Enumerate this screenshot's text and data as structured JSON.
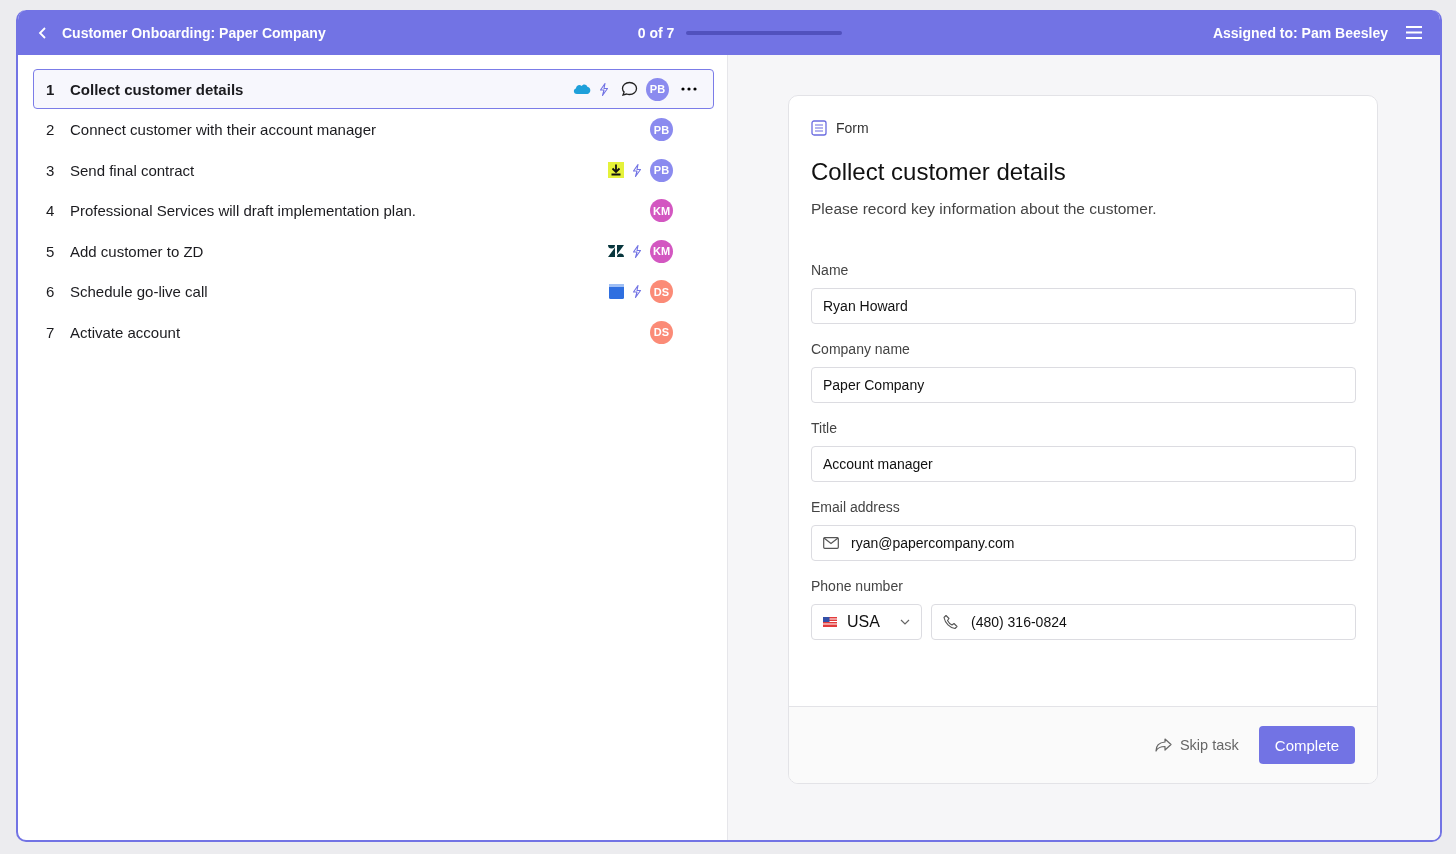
{
  "header": {
    "title": "Customer Onboarding: Paper Company",
    "progress": {
      "text": "0 of 7",
      "level": 0
    },
    "assignee": "Assigned to: Pam Beesley"
  },
  "tasks": [
    {
      "number": "1",
      "title": "Collect customer details",
      "selected": true,
      "kind": "salesforce",
      "automated": true,
      "avatar": {
        "initials": "PB",
        "color": "#8b8bef"
      }
    },
    {
      "number": "2",
      "title": "Connect customer with their account manager",
      "selected": false,
      "kind": "plain",
      "automated": false,
      "avatar": {
        "initials": "PB",
        "color": "#8b8bef"
      }
    },
    {
      "number": "3",
      "title": "Send final contract",
      "selected": false,
      "kind": "download",
      "automated": true,
      "avatar": {
        "initials": "PB",
        "color": "#8b8bef"
      }
    },
    {
      "number": "4",
      "title": "Professional Services will draft implementation plan.",
      "selected": false,
      "kind": "plain",
      "automated": false,
      "avatar": {
        "initials": "KM",
        "color": "#d357c1"
      }
    },
    {
      "number": "5",
      "title": "Add customer to ZD",
      "selected": false,
      "kind": "zendesk",
      "automated": true,
      "avatar": {
        "initials": "KM",
        "color": "#d357c1"
      }
    },
    {
      "number": "6",
      "title": "Schedule go-live call",
      "selected": false,
      "kind": "calendar",
      "automated": true,
      "avatar": {
        "initials": "DS",
        "color": "#fb8b77"
      }
    },
    {
      "number": "7",
      "title": "Activate account",
      "selected": false,
      "kind": "plain",
      "automated": false,
      "avatar": {
        "initials": "DS",
        "color": "#fb8b77"
      }
    }
  ],
  "form": {
    "type_label": "Form",
    "title": "Collect customer details",
    "description": "Please record key information about the customer.",
    "fields": [
      {
        "kind": "text",
        "label": "Name",
        "value": "Ryan Howard"
      },
      {
        "kind": "text",
        "label": "Company name",
        "value": "Paper Company"
      },
      {
        "kind": "text",
        "label": "Title",
        "value": "Account manager"
      },
      {
        "kind": "email",
        "label": "Email address",
        "value": "ryan@papercompany.com"
      },
      {
        "kind": "phone",
        "label": "Phone number",
        "country": "USA",
        "value": "(480) 316-0824"
      }
    ],
    "buttons": {
      "skip": "Skip task",
      "complete": "Complete"
    }
  }
}
